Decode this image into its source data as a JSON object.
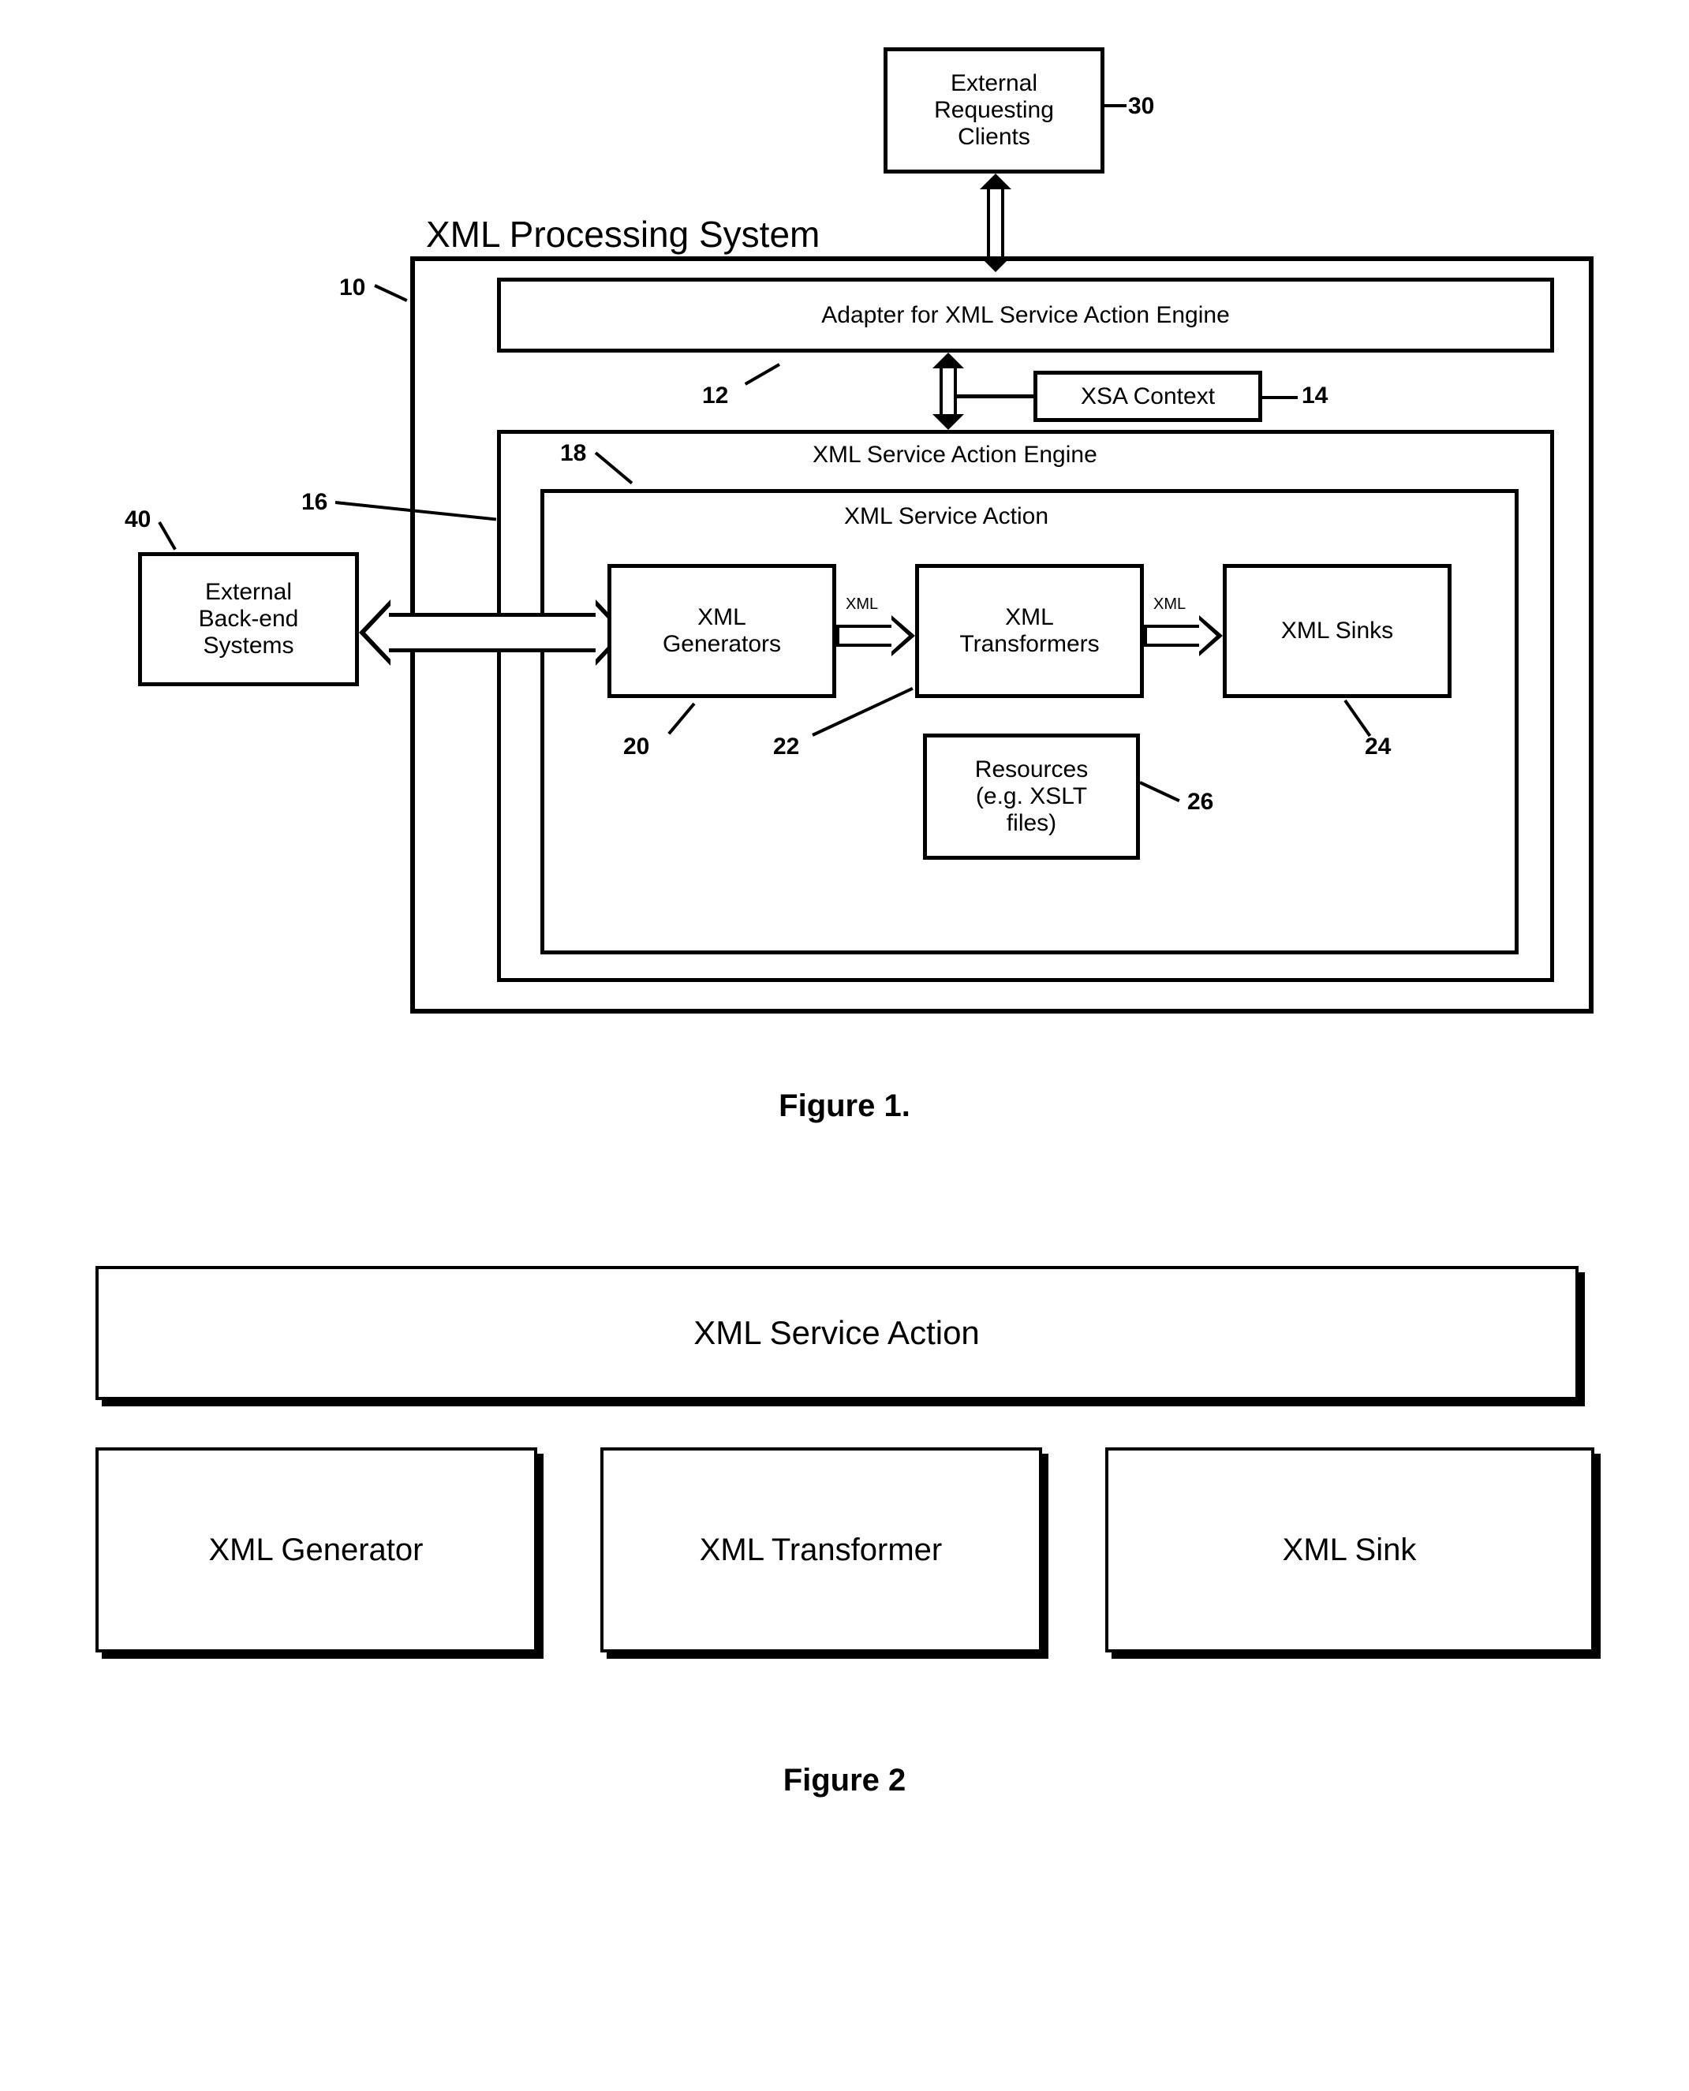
{
  "figure1": {
    "caption": "Figure 1.",
    "title": "XML Processing System",
    "externalClients": "External\nRequesting\nClients",
    "externalBackend": "External\nBack-end\nSystems",
    "adapter": "Adapter for XML Service Action Engine",
    "xsaContext": "XSA Context",
    "engine": "XML Service Action Engine",
    "action": "XML Service Action",
    "generators": "XML\nGenerators",
    "transformers": "XML\nTransformers",
    "sinks": "XML Sinks",
    "resources": "Resources\n(e.g. XSLT\nfiles)",
    "pipeLabel": "XML",
    "refs": {
      "r10": "10",
      "r12": "12",
      "r14": "14",
      "r16": "16",
      "r18": "18",
      "r20": "20",
      "r22": "22",
      "r24": "24",
      "r26": "26",
      "r30": "30",
      "r40": "40"
    }
  },
  "figure2": {
    "caption": "Figure 2",
    "serviceAction": "XML Service Action",
    "generator": "XML Generator",
    "transformer": "XML Transformer",
    "sink": "XML Sink"
  }
}
